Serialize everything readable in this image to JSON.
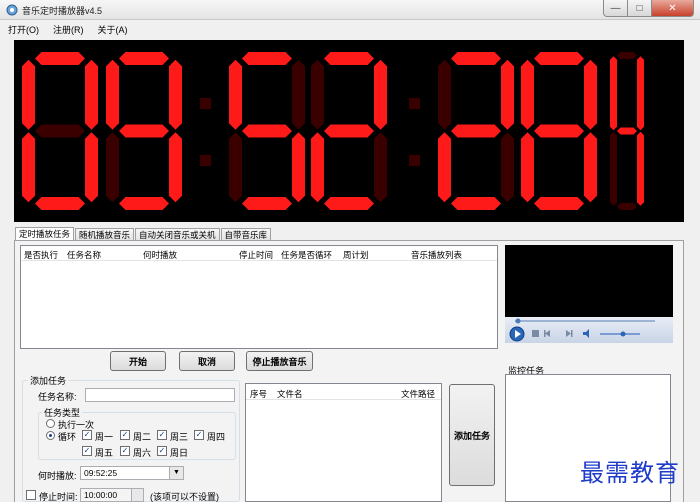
{
  "window": {
    "title": "音乐定时播放器v4.5",
    "controls": {
      "minimize": "—",
      "maximize": "□",
      "close": "✕"
    }
  },
  "menu": [
    "打开(O)",
    "注册(R)",
    "关于(A)"
  ],
  "clock": {
    "digits": "095228",
    "seconds_small": "4",
    "display_text": "09:52:28",
    "segment_color": "#ff1a1a",
    "dim_color": "#3a0000"
  },
  "tabs": [
    "定时播放任务",
    "随机播放音乐",
    "自动关闭音乐或关机",
    "自带音乐库"
  ],
  "task_list": {
    "columns": [
      "是否执行",
      "任务名称",
      "何时播放",
      "停止时间",
      "任务是否循环",
      "周计划",
      "音乐播放列表"
    ]
  },
  "buttons": {
    "start": "开始",
    "cancel": "取消",
    "stop_music": "停止播放音乐",
    "add_task": "添加任务"
  },
  "add_task": {
    "group_title": "添加任务",
    "name_label": "任务名称:",
    "name_value": "",
    "type_group": "任务类型",
    "once_label": "执行一次",
    "loop_label": "循环",
    "type_selected": "循环",
    "weekdays": [
      {
        "label": "周一",
        "checked": true
      },
      {
        "label": "周二",
        "checked": true
      },
      {
        "label": "周三",
        "checked": true
      },
      {
        "label": "周四",
        "checked": true
      },
      {
        "label": "周五",
        "checked": true
      },
      {
        "label": "周六",
        "checked": true
      },
      {
        "label": "周日",
        "checked": true
      }
    ],
    "play_time_label": "何时播放:",
    "play_time_value": "09:52:25",
    "stop_time_label": "停止时间:",
    "stop_time_value": "10:00:00",
    "stop_time_hint": "(该项可以不设置)"
  },
  "file_list": {
    "columns": [
      "序号",
      "文件名",
      "文件路径"
    ]
  },
  "monitor": {
    "title": "监控任务"
  },
  "watermark": "最需教育"
}
